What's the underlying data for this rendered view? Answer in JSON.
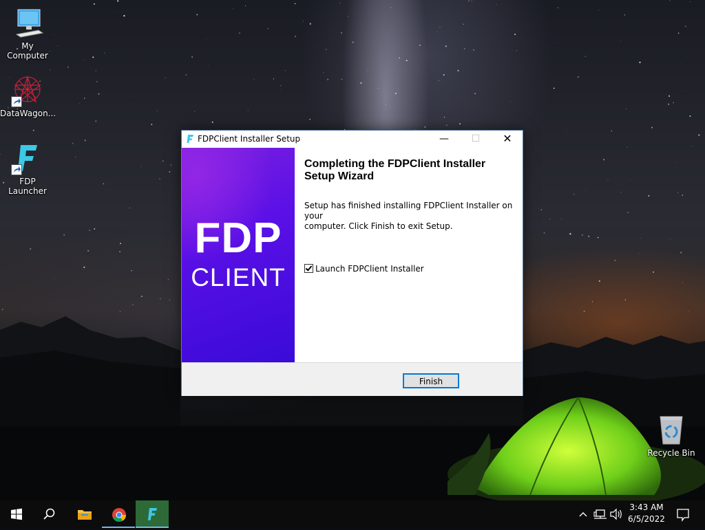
{
  "desktop": {
    "icons": [
      {
        "label": "My Computer"
      },
      {
        "label": "DataWagon..."
      },
      {
        "label": "FDP Launcher"
      },
      {
        "label": "Recycle Bin"
      }
    ]
  },
  "installer": {
    "title": "FDPClient Installer Setup",
    "banner": {
      "line1": "FDP",
      "line2": "CLIENT"
    },
    "heading": "Completing the FDPClient Installer\nSetup Wizard",
    "body": "Setup has finished installing FDPClient Installer on your\ncomputer. Click Finish to exit Setup.",
    "checkbox": {
      "label": "Launch FDPClient Installer",
      "checked": true
    },
    "finish_label": "Finish",
    "window_buttons": {
      "minimize": "—",
      "maximize": "☐",
      "close": "✕"
    }
  },
  "taskbar": {
    "items": [
      "start-icon",
      "search-icon",
      "file-explorer-icon",
      "chrome-icon",
      "fdp-launcher-icon"
    ],
    "active_item": "fdp-launcher-icon",
    "clock": {
      "time": "3:43 AM",
      "date": "6/5/2022"
    }
  },
  "colors": {
    "banner_purple": "#5a10e6",
    "fdp_cyan": "#3cc8e6",
    "finish_border": "#0078d7",
    "taskbar_active": "#2d6a37"
  }
}
